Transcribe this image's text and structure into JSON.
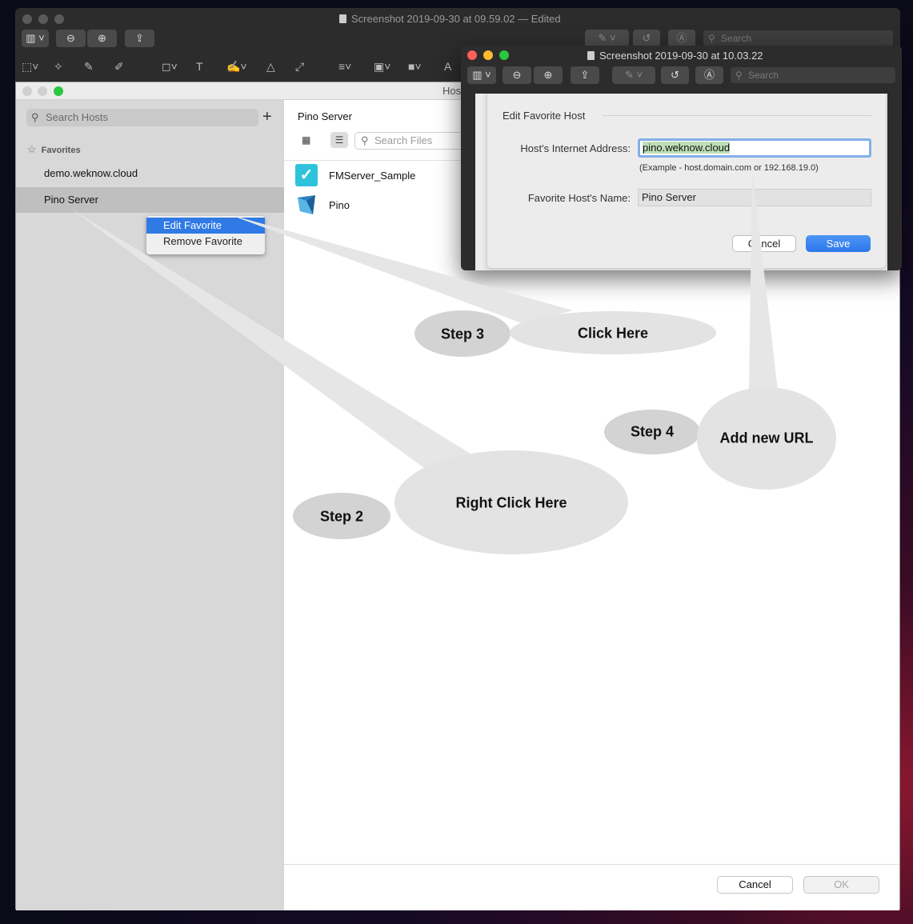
{
  "back_window": {
    "title": "Screenshot 2019-09-30 at 09.59.02 — Edited",
    "search_placeholder": "Search"
  },
  "hosts_window": {
    "title": "Hos",
    "search_placeholder": "Search Hosts",
    "add_label": "+",
    "favorites_header": "Favorites",
    "favorites": [
      {
        "label": "demo.weknow.cloud"
      },
      {
        "label": "Pino Server"
      }
    ],
    "context_menu": [
      "Edit Favorite",
      "Remove Favorite"
    ],
    "server_name": "Pino Server",
    "file_search_placeholder": "Search Files",
    "files": [
      {
        "name": "FMServer_Sample"
      },
      {
        "name": "Pino"
      }
    ],
    "cancel_label": "Cancel",
    "ok_label": "OK"
  },
  "front_window": {
    "title": "Screenshot 2019-09-30 at 10.03.22",
    "search_placeholder": "Search",
    "sheet": {
      "title": "Edit Favorite Host",
      "address_label": "Host's Internet Address:",
      "address_value": "pino.weknow.cloud",
      "address_example": "(Example - host.domain.com or 192.168.19.0)",
      "name_label": "Favorite Host's Name:",
      "name_value": "Pino Server",
      "cancel_label": "Cancel",
      "save_label": "Save"
    }
  },
  "annotations": {
    "step2": "Step 2",
    "step2_callout": "Right Click Here",
    "step3": "Step 3",
    "step3_callout": "Click Here",
    "step4": "Step 4",
    "step4_callout": "Add new URL"
  },
  "colors": {
    "accent": "#2f7ae5",
    "bubble_fill": "#e3e3e3",
    "bubble_dark": "#d3d3d3"
  }
}
